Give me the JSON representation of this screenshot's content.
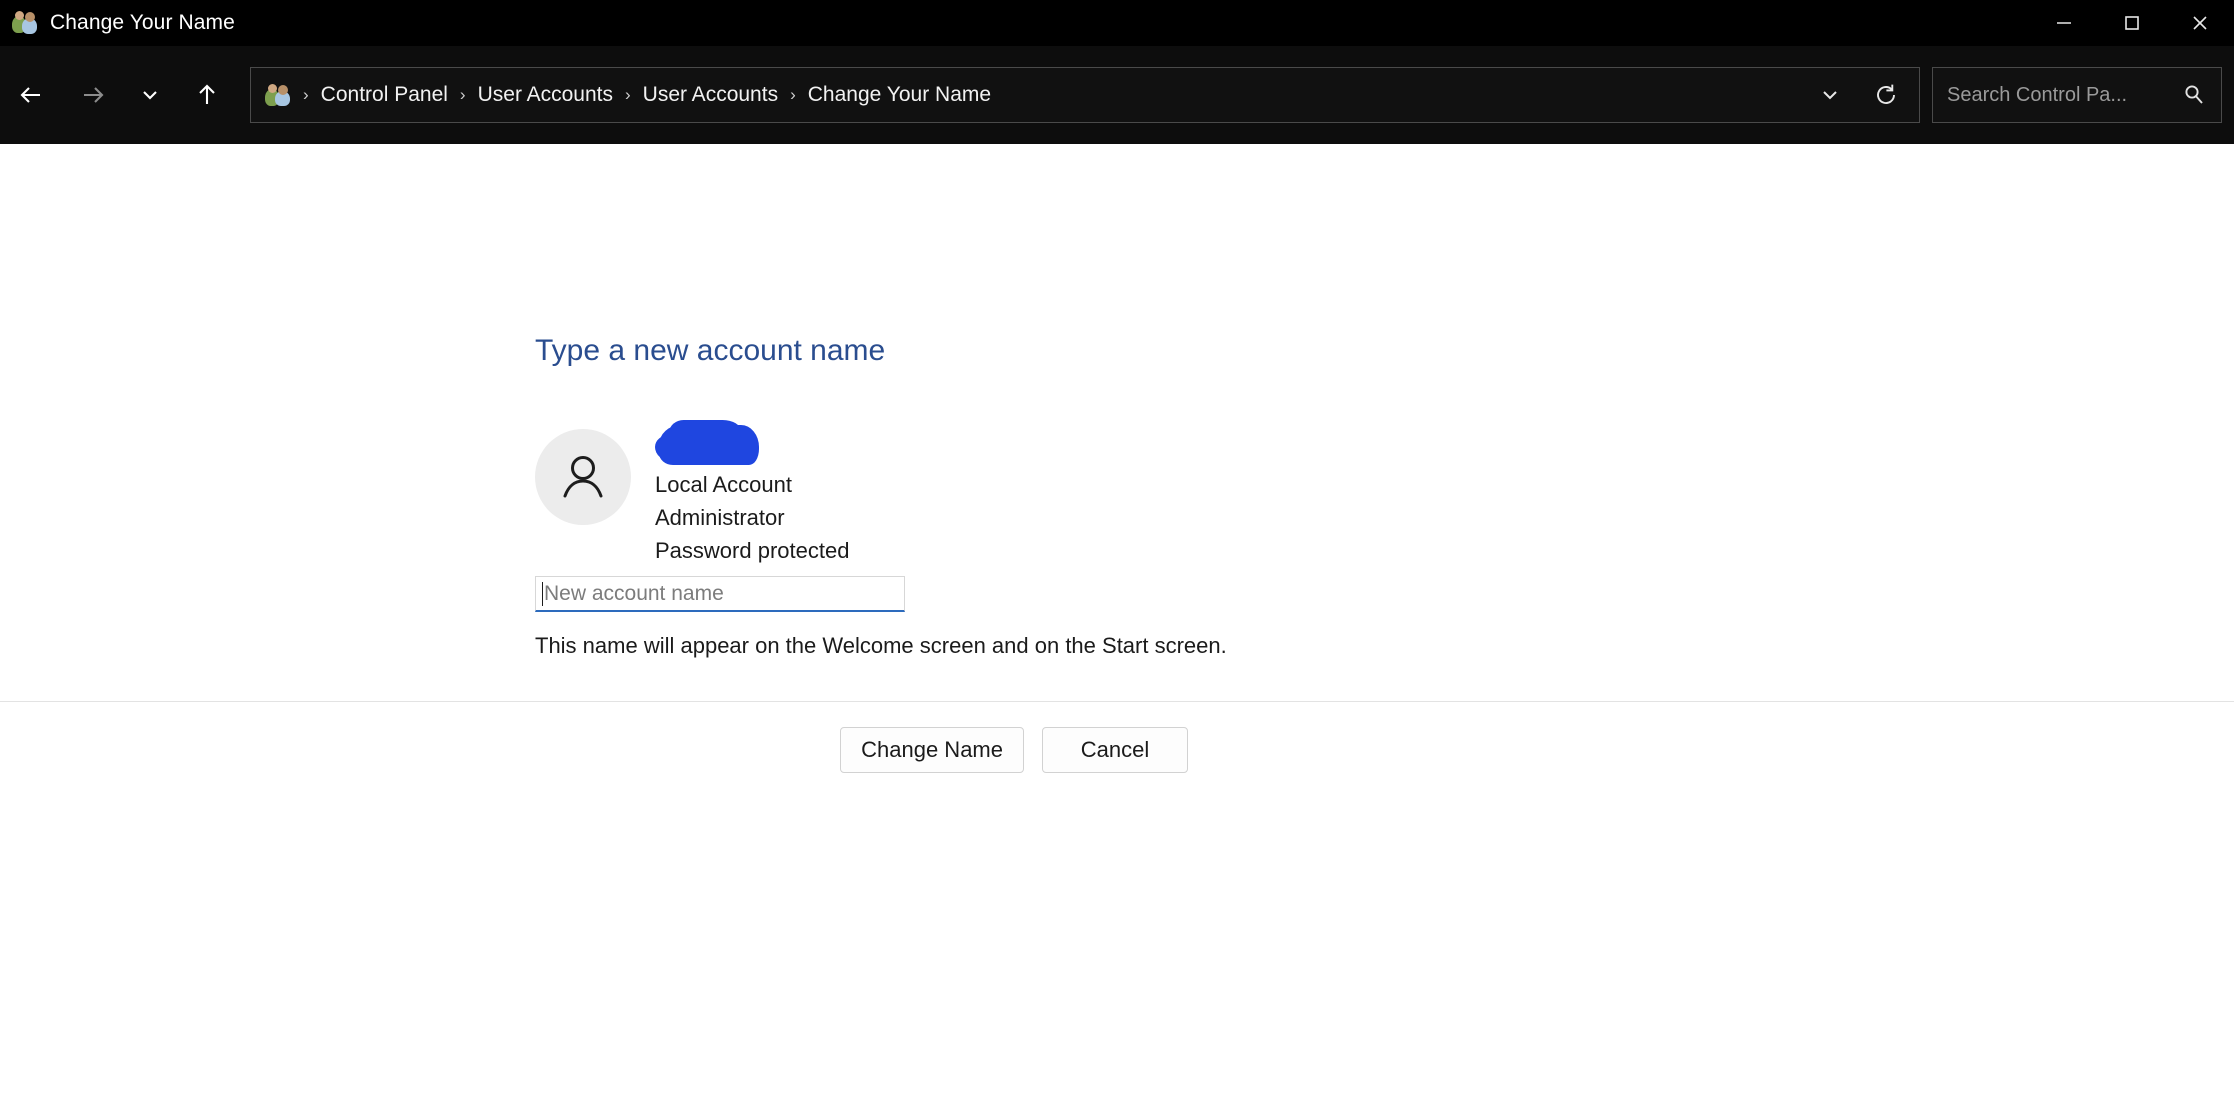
{
  "window": {
    "title": "Change Your Name",
    "app_icon": "user-accounts-icon",
    "controls": {
      "minimize": "minimize-icon",
      "maximize": "maximize-icon",
      "close": "close-icon"
    }
  },
  "toolbar": {
    "back": "back-arrow-icon",
    "forward": "forward-arrow-icon",
    "recent": "recent-locations-chevron-icon",
    "up": "up-arrow-icon",
    "address_dropdown": "chevron-down-icon",
    "refresh": "refresh-icon"
  },
  "breadcrumb": {
    "icon": "user-accounts-icon",
    "separator": "›",
    "items": [
      {
        "label": "Control Panel"
      },
      {
        "label": "User Accounts"
      },
      {
        "label": "User Accounts"
      },
      {
        "label": "Change Your Name"
      }
    ]
  },
  "search": {
    "placeholder": "Search Control Pa...",
    "value": "",
    "icon": "search-icon"
  },
  "main": {
    "heading": "Type a new account name",
    "heading_color": "#2a4d8f",
    "account": {
      "avatar_icon": "person-icon",
      "name_redacted": true,
      "redaction_color": "#1f46e0",
      "lines": [
        "Local Account",
        "Administrator",
        "Password protected"
      ]
    },
    "name_input": {
      "placeholder": "New account name",
      "value": "",
      "focused": true,
      "focus_color": "#2d6bbd"
    },
    "hint": "This name will appear on the Welcome screen and on the Start screen.",
    "buttons": {
      "primary": "Change Name",
      "secondary": "Cancel"
    }
  }
}
